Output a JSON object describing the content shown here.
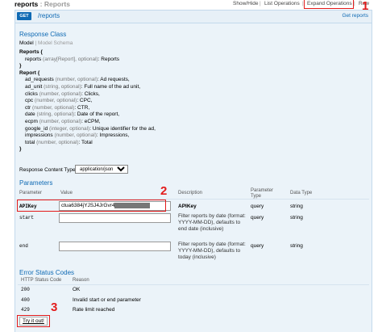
{
  "header": {
    "title_main": "reports",
    "title_sep": " : ",
    "title_sub": "Reports",
    "links": [
      "Show/Hide",
      "List Operations",
      "Expand Operations",
      "Raw"
    ],
    "separators": [
      "|",
      "|",
      "|"
    ]
  },
  "operation": {
    "method": "GET",
    "path": "/reports",
    "summary": "Get reports"
  },
  "response_class": {
    "heading": "Response Class",
    "tab_model": "Model",
    "tab_schema": "Model Schema",
    "lines": [
      {
        "bold": "Reports {",
        "type": "",
        "rest": ""
      },
      {
        "indent": true,
        "name": "reports ",
        "type": "(array[Report], optional)",
        "rest": ": Reports"
      },
      {
        "bold": "}",
        "type": "",
        "rest": ""
      },
      {
        "bold": "Report {",
        "type": "",
        "rest": ""
      },
      {
        "indent": true,
        "name": "ad_requests ",
        "type": "(number, optional)",
        "rest": ": Ad requests,"
      },
      {
        "indent": true,
        "name": "ad_unit ",
        "type": "(string, optional)",
        "rest": ": Full name of the ad unit,"
      },
      {
        "indent": true,
        "name": "clicks ",
        "type": "(number, optional)",
        "rest": ": Clicks,"
      },
      {
        "indent": true,
        "name": "cpc ",
        "type": "(number, optional)",
        "rest": ": CPC,"
      },
      {
        "indent": true,
        "name": "ctr ",
        "type": "(number, optional)",
        "rest": ": CTR,"
      },
      {
        "indent": true,
        "name": "date ",
        "type": "(string, optional)",
        "rest": ": Date of the report,"
      },
      {
        "indent": true,
        "name": "ecpm ",
        "type": "(number, optional)",
        "rest": ": eCPM,"
      },
      {
        "indent": true,
        "name": "google_id ",
        "type": "(integer, optional)",
        "rest": ": Unique identifier for the ad,"
      },
      {
        "indent": true,
        "name": "impressions ",
        "type": "(number, optional)",
        "rest": ": Impressions,"
      },
      {
        "indent": true,
        "name": "total ",
        "type": "(number, optional)",
        "rest": ": Total"
      },
      {
        "bold": "}",
        "type": "",
        "rest": ""
      }
    ]
  },
  "content_type": {
    "label": "Response Content Type",
    "selected": "application/json"
  },
  "parameters": {
    "heading": "Parameters",
    "columns": [
      "Parameter",
      "Value",
      "Description",
      "Parameter Type",
      "Data Type"
    ],
    "rows": [
      {
        "name": "APIKey",
        "value": "ctua6384jYJSJ4JrGvr4",
        "description": "APIKey",
        "ptype": "query",
        "dtype": "string"
      },
      {
        "name": "start",
        "value": "",
        "description": "Filter reports by date (format: YYYY-MM-DD), defaults to end date (inclusive)",
        "ptype": "query",
        "dtype": "string"
      },
      {
        "name": "end",
        "value": "",
        "description": "Filter reports by date (format: YYYY-MM-DD), defaults to today (inclusive)",
        "ptype": "query",
        "dtype": "string"
      }
    ]
  },
  "errors": {
    "heading": "Error Status Codes",
    "columns": [
      "HTTP Status Code",
      "Reason"
    ],
    "rows": [
      {
        "code": "200",
        "reason": "OK"
      },
      {
        "code": "400",
        "reason": "Invalid start or end parameter"
      },
      {
        "code": "429",
        "reason": "Rate limit reached"
      }
    ]
  },
  "try_button": "Try it out!",
  "callouts": [
    "1",
    "2",
    "3"
  ],
  "colors": {
    "accent": "#0f6ab4",
    "callout": "#e31b1b",
    "panel": "#ebf3f9"
  }
}
